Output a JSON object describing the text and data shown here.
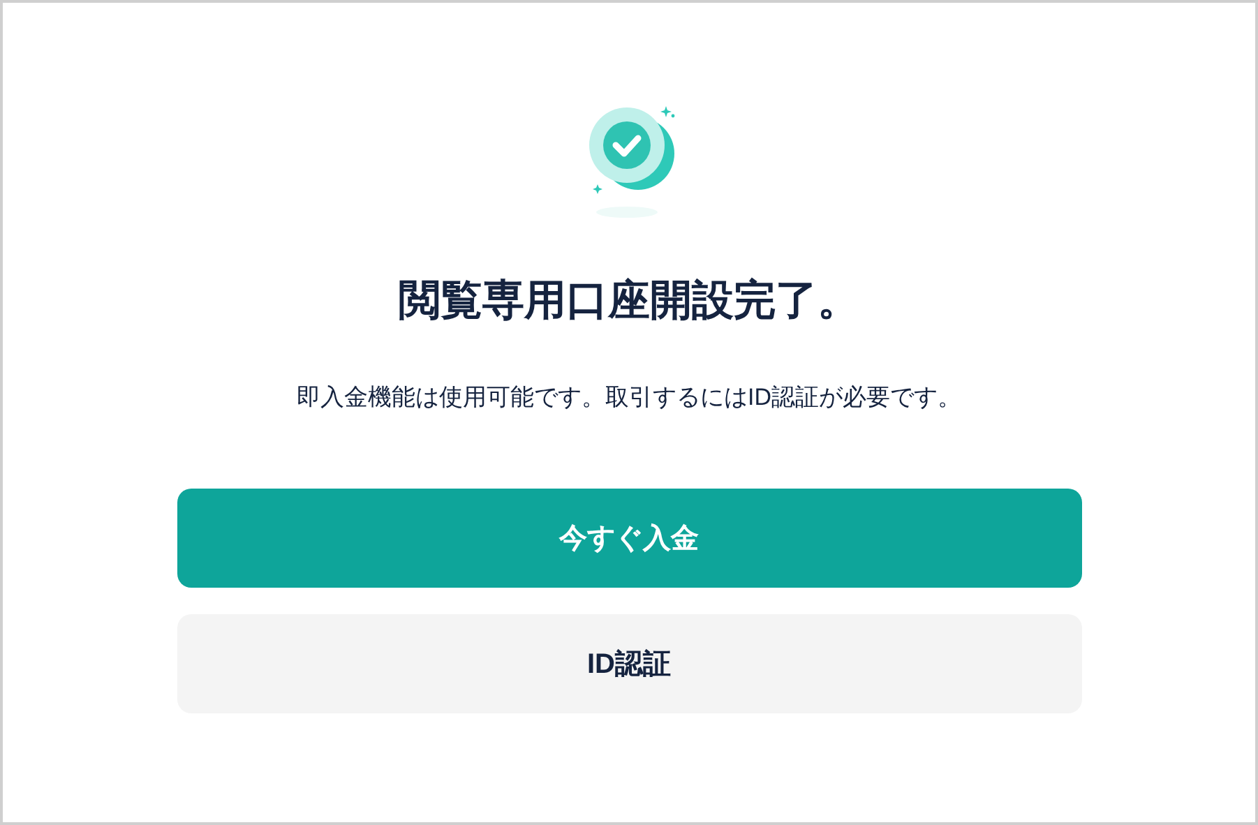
{
  "title": "閲覧専用口座開設完了。",
  "message": "即入金機能は使用可能です。取引するにはID認証が必要です。",
  "buttons": [
    {
      "label": "今すぐ入金",
      "kind": "primary"
    },
    {
      "label": "ID認証",
      "kind": "secondary"
    }
  ]
}
